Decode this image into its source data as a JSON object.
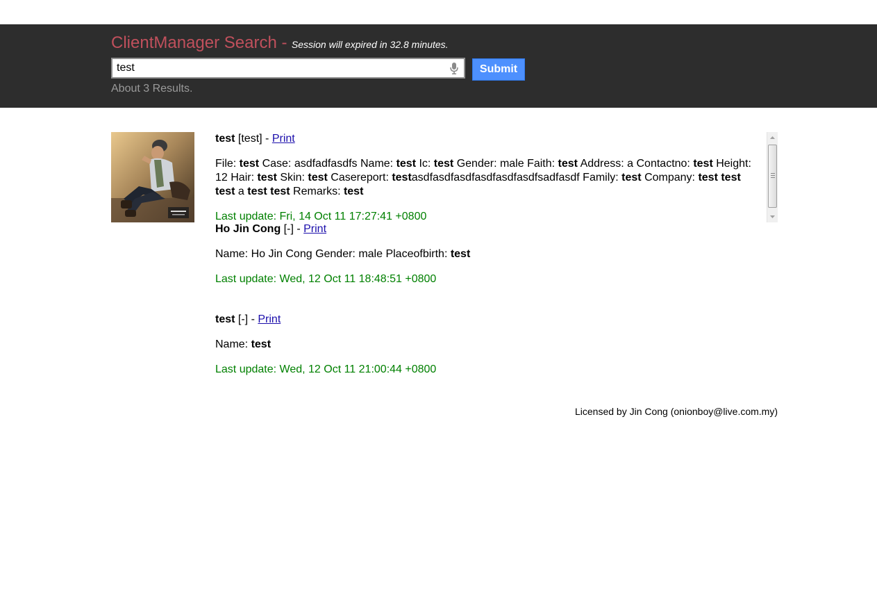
{
  "header": {
    "title": "ClientManager Search -",
    "session_note": "Session will expired in 32.8 minutes.",
    "search": {
      "value": "test"
    },
    "submit_label": "Submit",
    "results_count": "About 3 Results."
  },
  "results": [
    {
      "title": "test",
      "tag": "[test]",
      "separator": "-",
      "print_label": "Print",
      "body": [
        {
          "t": "File: "
        },
        {
          "t": "test",
          "b": true
        },
        {
          "t": " Case: asdfadfasdfs Name: "
        },
        {
          "t": "test",
          "b": true
        },
        {
          "t": " Ic: "
        },
        {
          "t": "test",
          "b": true
        },
        {
          "t": " Gender: male Faith: "
        },
        {
          "t": "test",
          "b": true
        },
        {
          "t": " Address: a Contactno: "
        },
        {
          "t": "test",
          "b": true
        },
        {
          "t": " Height: 12 Hair: "
        },
        {
          "t": "test",
          "b": true
        },
        {
          "t": " Skin: "
        },
        {
          "t": "test",
          "b": true
        },
        {
          "t": " Casereport: "
        },
        {
          "t": "test",
          "b": true
        },
        {
          "t": "asdfasdfasdfasdfasdfasdfsadfasdf Family: "
        },
        {
          "t": "test",
          "b": true
        },
        {
          "t": " Company: "
        },
        {
          "t": "test",
          "b": true
        },
        {
          "t": " "
        },
        {
          "t": "test",
          "b": true
        },
        {
          "t": " "
        },
        {
          "t": "test",
          "b": true
        },
        {
          "t": " a "
        },
        {
          "t": "test",
          "b": true
        },
        {
          "t": " "
        },
        {
          "t": "test",
          "b": true
        },
        {
          "t": " Remarks: "
        },
        {
          "t": "test",
          "b": true
        }
      ],
      "last_update": "Last update: Fri, 14 Oct 11 17:27:41 +0800"
    },
    {
      "title": "Ho Jin Cong",
      "tag": "[-]",
      "separator": "-",
      "print_label": "Print",
      "body": [
        {
          "t": "Name: Ho Jin Cong Gender: male Placeofbirth: "
        },
        {
          "t": "test",
          "b": true
        }
      ],
      "last_update": "Last update: Wed, 12 Oct 11 18:48:51 +0800"
    },
    {
      "title": "test",
      "tag": "[-]",
      "separator": "-",
      "print_label": "Print",
      "body": [
        {
          "t": "Name: "
        },
        {
          "t": "test",
          "b": true
        }
      ],
      "last_update": "Last update: Wed, 12 Oct 11 21:00:44 +0800"
    }
  ],
  "footer": {
    "license": "Licensed by Jin Cong (onionboy@live.com.my)"
  },
  "colors": {
    "header_bg": "#2d2d2d",
    "title": "#c0505c",
    "submit": "#4d90fe",
    "link": "#1a0dab",
    "date": "#008000"
  },
  "icons": {
    "search_mic": "microphone-icon",
    "photo": "profile-photo"
  }
}
